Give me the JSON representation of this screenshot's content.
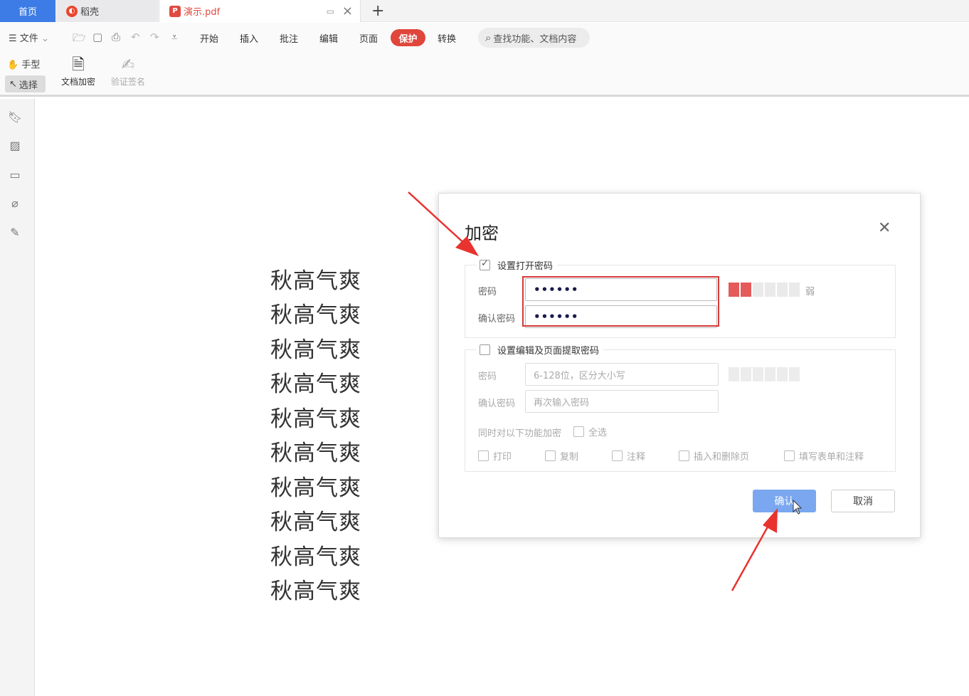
{
  "tabs": {
    "home": "首页",
    "docer": "稻壳",
    "pdf": "演示.pdf",
    "add": "+"
  },
  "menubar": {
    "file": "文件",
    "items": [
      "开始",
      "插入",
      "批注",
      "编辑",
      "页面",
      "保护",
      "转换"
    ],
    "active": "保护",
    "search_placeholder": "查找功能、文档内容"
  },
  "ribbon": {
    "hand": "手型",
    "select": "选择",
    "encrypt": "文档加密",
    "verify_sign": "验证签名"
  },
  "document": {
    "lines": [
      "秋高气爽",
      "秋高气爽",
      "秋高气爽",
      "秋高气爽",
      "秋高气爽",
      "秋高气爽",
      "秋高气爽",
      "秋高气爽",
      "秋高气爽",
      "秋高气爽"
    ]
  },
  "dialog": {
    "title": "加密",
    "open_password": {
      "checkbox_label": "设置打开密码",
      "checked": true,
      "password_label": "密码",
      "password_value": "••••••",
      "confirm_label": "确认密码",
      "confirm_value": "••••••",
      "strength_text": "弱",
      "strength_level": 0.33
    },
    "edit_password": {
      "checkbox_label": "设置编辑及页面提取密码",
      "checked": false,
      "password_label": "密码",
      "password_placeholder": "6-128位，区分大小写",
      "confirm_label": "确认密码",
      "confirm_placeholder": "再次输入密码",
      "also_encrypt_label": "同时对以下功能加密",
      "select_all": "全选",
      "options": [
        "打印",
        "复制",
        "注释",
        "插入和删除页",
        "填写表单和注释"
      ]
    },
    "confirm_button": "确认",
    "cancel_button": "取消"
  },
  "colors": {
    "accent_blue": "#3d7ce6",
    "protect_red": "#e0463b",
    "annotation_red": "#e8332f",
    "confirm_button": "#7aa7f0"
  }
}
